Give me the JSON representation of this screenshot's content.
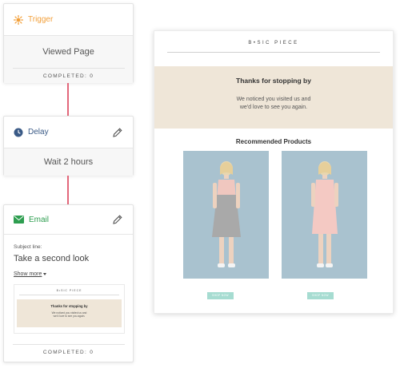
{
  "workflow": {
    "trigger": {
      "title": "Trigger",
      "title_color": "#f2a03b",
      "icon": "sun-icon",
      "event": "Viewed Page",
      "completed": "COMPLETED: 0"
    },
    "delay": {
      "title": "Delay",
      "icon": "clock-icon",
      "wait": "Wait 2 hours"
    },
    "email": {
      "title": "Email",
      "icon": "envelope-icon",
      "subject_label": "Subject line:",
      "subject": "Take a second look",
      "show_more": "Show more",
      "completed": "COMPLETED: 0"
    },
    "connector_color": "#e2677a"
  },
  "email_preview": {
    "logo": "B•SIC PIECE",
    "heading": "Thanks for stopping by",
    "body_line1": "We noticed you visited us and",
    "body_line2": "we'd love to see you again.",
    "subheading": "Recommended Products",
    "band_color": "#efe6d8",
    "products": [
      {
        "name": "grey-dress",
        "color": "#b5b5b5",
        "button": "SHOP NOW"
      },
      {
        "name": "pink-dress",
        "color": "#f4c9c3",
        "button": "SHOP NOW"
      }
    ],
    "button_color": "#a6dcd1"
  }
}
